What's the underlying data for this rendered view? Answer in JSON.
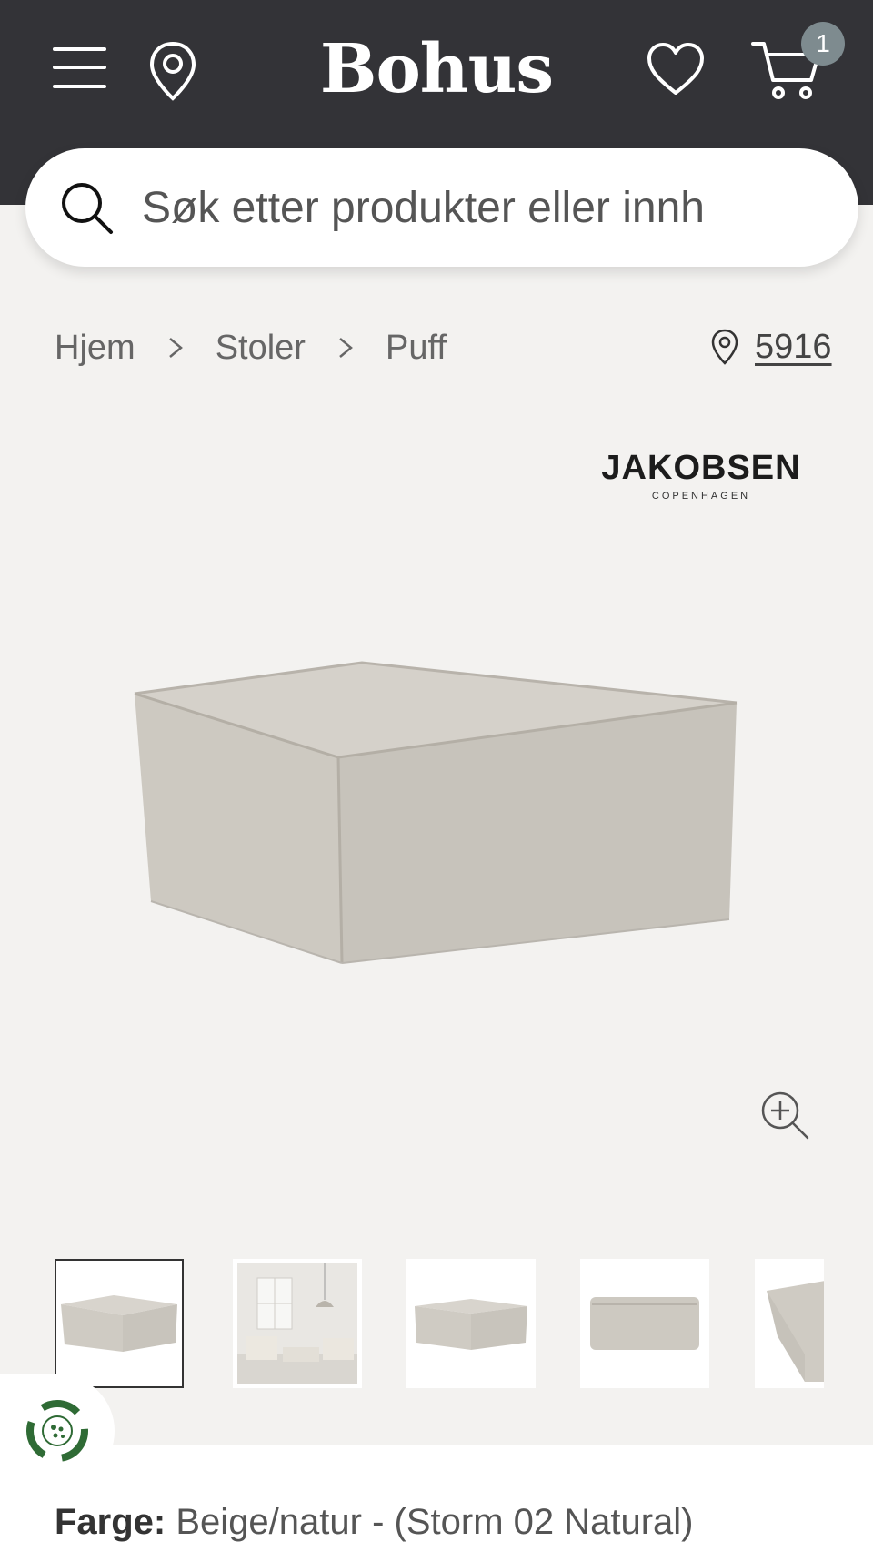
{
  "header": {
    "logo": "Bohus",
    "cart_count": "1",
    "colors": {
      "bar": "#333337",
      "badge": "#7e8b8f"
    }
  },
  "search": {
    "placeholder": "Søk etter produkter eller innh"
  },
  "breadcrumb": {
    "items": [
      "Hjem",
      "Stoler",
      "Puff"
    ]
  },
  "store": {
    "number": "5916"
  },
  "product": {
    "brand": "JAKOBSEN",
    "brand_sub": "COPENHAGEN",
    "color_label": "Farge:",
    "color_value": "Beige/natur - (Storm 02 Natural)"
  },
  "gallery": {
    "thumbnails": [
      "thumb-1",
      "thumb-2",
      "thumb-3",
      "thumb-4",
      "thumb-5"
    ],
    "active_index": 0
  },
  "icons": [
    "menu-icon",
    "location-pin-icon",
    "heart-icon",
    "cart-icon",
    "search-icon",
    "chevron-right-icon",
    "zoom-in-icon",
    "recycle-icon"
  ]
}
